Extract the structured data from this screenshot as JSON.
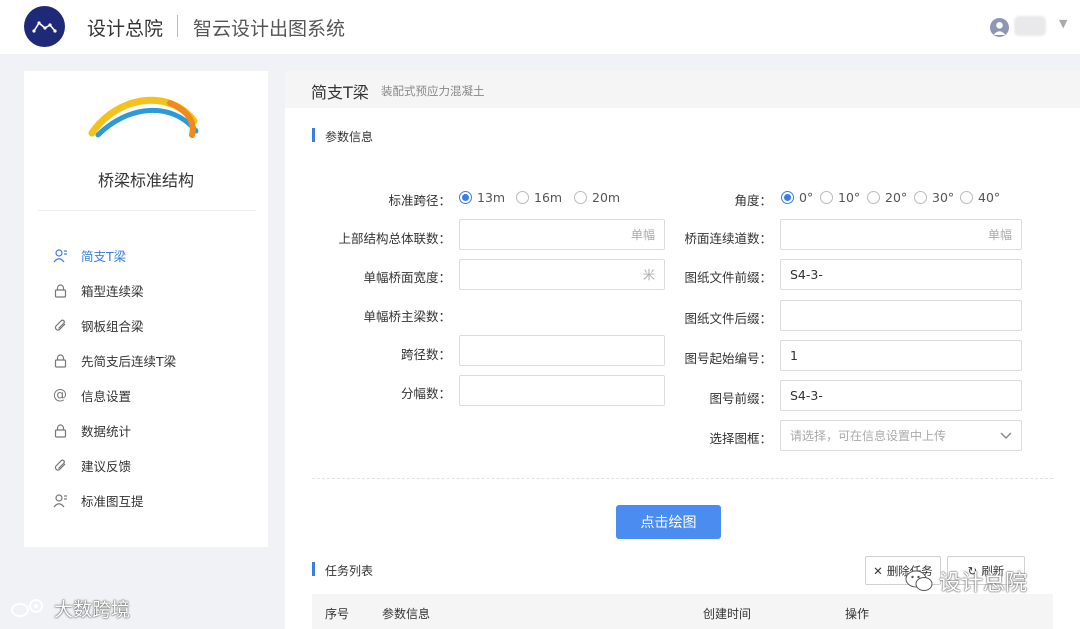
{
  "header": {
    "brand": "设计总院",
    "system_title": "智云设计出图系统"
  },
  "sidebar": {
    "title": "桥梁标准结构",
    "items": [
      {
        "label": "简支T梁",
        "icon": "user-icon",
        "active": true
      },
      {
        "label": "箱型连续梁",
        "icon": "lock-icon",
        "active": false
      },
      {
        "label": "钢板组合梁",
        "icon": "paperclip-icon",
        "active": false
      },
      {
        "label": "先简支后连续T梁",
        "icon": "lock-icon",
        "active": false
      },
      {
        "label": "信息设置",
        "icon": "at-icon",
        "active": false
      },
      {
        "label": "数据统计",
        "icon": "lock-icon",
        "active": false
      },
      {
        "label": "建议反馈",
        "icon": "paperclip-icon",
        "active": false
      },
      {
        "label": "标准图互提",
        "icon": "user-group-icon",
        "active": false
      }
    ]
  },
  "page": {
    "title": "简支T梁",
    "subtitle": "装配式预应力混凝土"
  },
  "params": {
    "section_title": "参数信息",
    "span": {
      "label": "标准跨径：",
      "options": [
        "13m",
        "16m",
        "20m"
      ],
      "selected": "13m"
    },
    "angle": {
      "label": "角度：",
      "options": [
        "0°",
        "10°",
        "20°",
        "30°",
        "40°"
      ],
      "selected": "0°"
    },
    "total_joint_count": {
      "label": "上部结构总体联数：",
      "value": "",
      "suffix": "单幅"
    },
    "deck_lane_count": {
      "label": "桥面连续道数：",
      "value": "",
      "suffix": "单幅"
    },
    "deck_width": {
      "label": "单幅桥面宽度：",
      "value": "",
      "suffix": "米"
    },
    "file_prefix": {
      "label": "图纸文件前缀：",
      "value": "S4-3-"
    },
    "main_beam_count": {
      "label": "单幅桥主梁数："
    },
    "file_suffix": {
      "label": "图纸文件后缀：",
      "value": ""
    },
    "span_count": {
      "label": "跨径数：",
      "value": ""
    },
    "start_number": {
      "label": "图号起始编号：",
      "value": "1"
    },
    "split_count": {
      "label": "分幅数：",
      "value": ""
    },
    "drawing_prefix": {
      "label": "图号前缀：",
      "value": "S4-3-"
    },
    "frame": {
      "label": "选择图框：",
      "placeholder": "请选择，可在信息设置中上传",
      "value": ""
    }
  },
  "actions": {
    "draw": "点击绘图"
  },
  "tasks": {
    "section_title": "任务列表",
    "btn_delete": "删除任务",
    "btn_refresh": "刷新",
    "columns": [
      "序号",
      "参数信息",
      "创建时间",
      "操作"
    ]
  },
  "watermarks": {
    "wechat": "设计总院",
    "weibo": "大数跨境"
  },
  "colors": {
    "accent": "#3a7ee4",
    "primary_button": "#4a8cf0",
    "logo_bg": "#1e2a78"
  }
}
